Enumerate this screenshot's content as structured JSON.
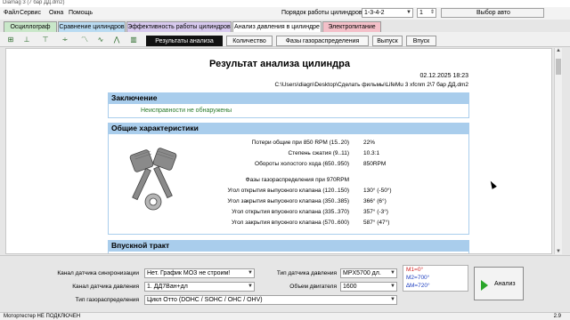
{
  "window": {
    "title": "Diamag 3 (7 бар ДД.dm2)"
  },
  "menu": [
    "Файл",
    "Сервис",
    "Окна",
    "Помощь"
  ],
  "top": {
    "firing_order_label": "Порядок работы цилиндров",
    "firing_order_value": "1-3-4-2",
    "cylinder_value": "1",
    "car_select_label": "Выбор авто"
  },
  "tabs": [
    "Осциллограф",
    "Сравнение цилиндров",
    "Эффективность работы цилиндров",
    "Анализ давления в цилиндре",
    "Электропитание"
  ],
  "subtabs": [
    "Результаты анализа",
    "Количество",
    "Фазы газораспределения",
    "Выпуск",
    "Впуск"
  ],
  "report": {
    "title": "Результат анализа цилиндра",
    "date": "02.12.2025 18:23",
    "path": "C:\\Users\\diagn\\Desktop\\Сделать фильмы\\LifeMu 3 xfcnm 2\\7 бар ДД.dm2",
    "conclusion_header": "Заключение",
    "conclusion_text": "Неисправности не обнаружены",
    "general_header": "Общие характеристики",
    "general_rows": [
      {
        "label": "Потери общие при 850 RPM (15..20)",
        "value": "22%"
      },
      {
        "label": "Степень сжатия (9..11)",
        "value": "10.3:1"
      },
      {
        "label": "Обороты холостого хода (650..950)",
        "value": "850RPM"
      }
    ],
    "phase_title": "Фазы газораспределения при 970RPM",
    "phase_rows": [
      {
        "label": "Угол открытия выпускного клапана (120..150)",
        "value": "130° (-50°)"
      },
      {
        "label": "Угол закрытия выпускного клапана (350..385)",
        "value": "366° (6°)"
      },
      {
        "label": "Угол открытия впускного клапана (335..370)",
        "value": "357° (-3°)"
      },
      {
        "label": "Угол закрытия впускного клапана (570..600)",
        "value": "587° (47°)"
      }
    ],
    "intake_header": "Впускной тракт"
  },
  "bottom": {
    "sync_sensor_label": "Канал датчика синхронизации",
    "sync_sensor_value": "Нет. График МОЗ не строим!",
    "pressure_channel_label": "Канал датчика давления",
    "pressure_channel_value": "1. ДД7Ван+дл",
    "pressure_type_label": "Тип датчика давления",
    "pressure_type_value": "MPX5700 дл.",
    "engine_volume_label": "Объем двигателя",
    "engine_volume_value": "1600",
    "timing_type_label": "Тип газораспределения",
    "timing_type_value": "Цикл Отто (DOHC / SOHC / OHC / OHV)",
    "markers": [
      "M1=0°",
      "M2=700°",
      "∆M=720°"
    ],
    "analyze_label": "Анализ"
  },
  "status": {
    "left": "Мотортестер НЕ ПОДКЛЮЧЕН",
    "right": "2.9"
  },
  "colors": {
    "section": "#a9cdec",
    "ok_text": "#2a7a2a",
    "marker_red": "#d02020",
    "tab_active": "#111111"
  },
  "icons": [
    "graph-icon",
    "pistons-image",
    "play-icon",
    "dropdown-arrow-icon"
  ]
}
